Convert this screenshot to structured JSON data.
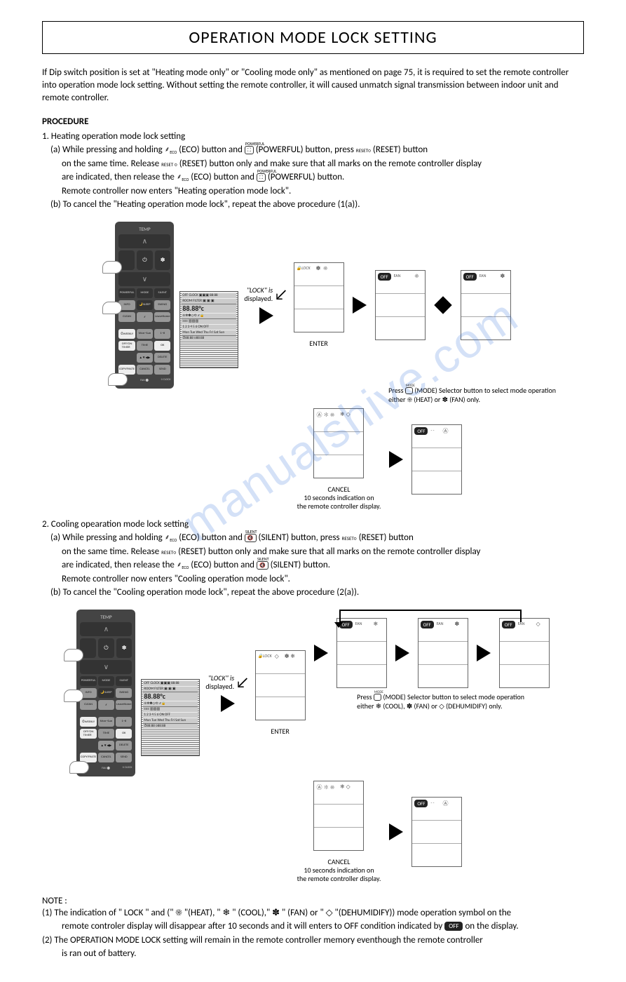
{
  "title": "OPERATION MODE LOCK SETTING",
  "intro": "If Dip switch position is set at \"Heating mode only\" or \"Cooling mode only\" as mentioned on page 75, it is required to set the remote controller into operation mode lock setting. Without setting the remote controller, it will caused unmatch signal transmission between indoor unit and remote controller.",
  "procedure_heading": "PROCEDURE",
  "heating": {
    "heading": "1. Heating operation mode lock setting",
    "a_intro": "(a) While pressing and holding",
    "eco_label": "(ECO) button and",
    "powerful_label": "(POWERFUL) button, press",
    "reset_label": "(RESET) button",
    "a_line2": "on the same time. Release",
    "reset2": "(RESET) button only and make sure that all marks on the remote controller display",
    "a_line3": "are indicated, then release the",
    "eco2": "(ECO) button and",
    "powerful2": "(POWERFUL) button.",
    "a_line4": "Remote controller now enters \"Heating operation mode lock\".",
    "b": "(b) To cancel the \"Heating operation mode lock\", repeat the above procedure (1(a))."
  },
  "diagram": {
    "lock_displayed_1": "\"LOCK\" is",
    "lock_displayed_2": "displayed.",
    "enter": "ENTER",
    "cancel": "CANCEL",
    "cancel_note_1": "10 seconds indication on",
    "cancel_note_2": "the remote controller display.",
    "mode_note_1": "Press",
    "mode_note_2": "(MODE) Selector button to select mode operation",
    "heating_either": "either ☀ (HEAT) or ✽ (FAN) only.",
    "cooling_either": "either ❄ (COOL), ✽ (FAN) or ◇ (DEHUMIDIFY) only."
  },
  "cooling": {
    "heading": "2. Cooling opearation mode lock setting",
    "a_intro": "(a) While pressing and holding",
    "eco_label": "(ECO) button and",
    "silent_label": "(SILENT) button, press",
    "reset_label": "(RESET) button",
    "a_line2": "on the same time. Release",
    "reset2": "(RESET) button only and make sure that all marks on the remote controller display",
    "a_line3": "are indicated, then release the",
    "eco2": "(ECO) button and",
    "silent2": "(SILENT) button.",
    "a_line4": "Remote controller now enters \"Cooling operation mode lock\".",
    "b": "(b) To cancel the \"Cooling operation mode lock\", repeat the above procedure (2(a))."
  },
  "notes": {
    "heading": "NOTE :",
    "n1_a": "(1) The indication of \" LOCK \" and (\" ☀ \"(HEAT), \" ❄ \" (COOL),\" ✽ \" (FAN) or \" ◇ \"(DEHUMIDIFY)) mode operation symbol on the",
    "n1_b": "remote controler display will disappear after 10 seconds and it will enters to OFF condition indicated by",
    "n1_c": "on the display.",
    "n2_a": "(2) The OPERATION MODE LOCK setting will remain in the remote controller memory eventhough the remote controller",
    "n2_b": "is ran out of battery."
  },
  "remote": {
    "temp": "TEMP",
    "power": "⏻",
    "fan": "FAN",
    "labels": {
      "powerful": "POWERFUL",
      "mode": "MODE",
      "silent": "SILENT",
      "info": "INFO",
      "sleep": "SLEEP",
      "swing": "SWING",
      "clean": "CLEAN",
      "leaveho": "LeaveHome",
      "weekly": "WEEKLY",
      "monsun": "Mon~Sun",
      "oneto6": "1~6",
      "off_timer": "OFF TIMER",
      "on": "ON",
      "time": "TIME",
      "ok": "OK",
      "delete": "DELETE",
      "copypaste": "COPY/PASTE",
      "cancel": "CANCEL",
      "send": "SEND",
      "reset": "RESET",
      "clock": "CLOCK"
    }
  },
  "icons": {
    "eco_top": "ECO",
    "powerful_top": "POWERFUL",
    "silent_top": "SILENT",
    "reset_top": "RESET",
    "off": "OFF"
  },
  "watermark": "manualshive.com"
}
